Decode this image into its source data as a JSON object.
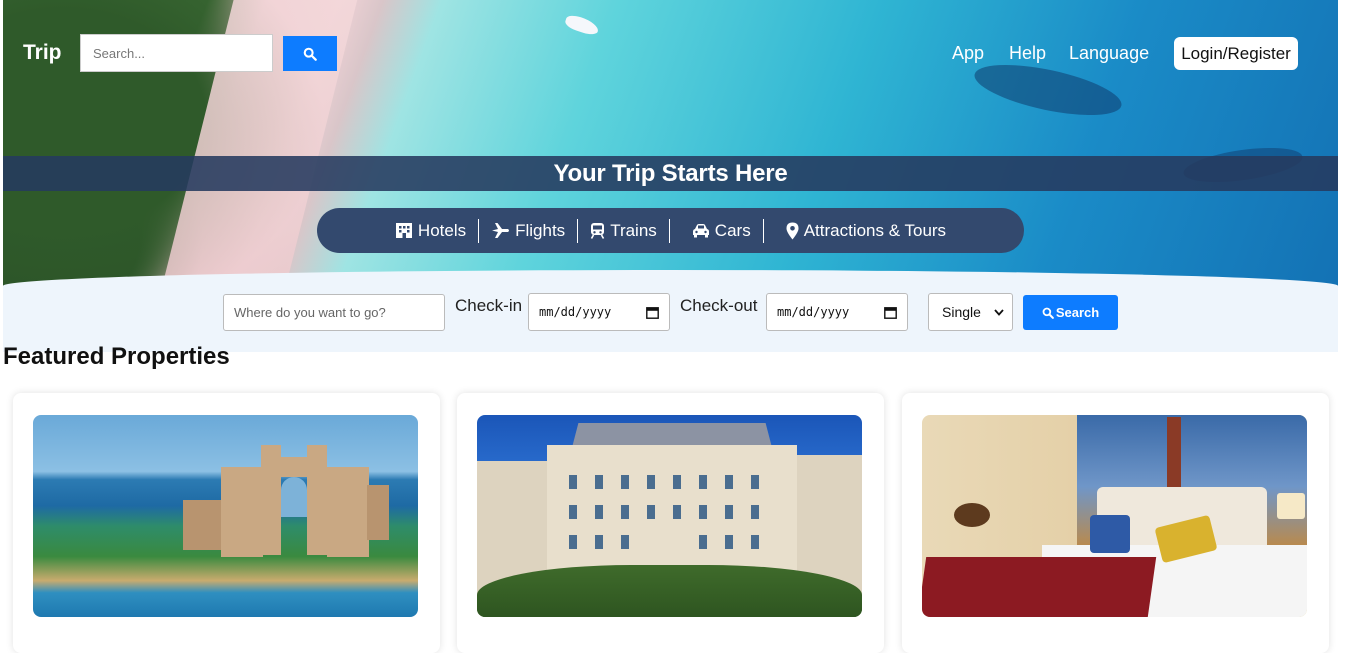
{
  "header": {
    "brand": "Trip",
    "search_placeholder": "Search...",
    "nav": [
      "App",
      "Help",
      "Language"
    ],
    "login_label": "Login/Register"
  },
  "hero": {
    "banner_title": "Your Trip Starts Here",
    "categories": [
      {
        "label": "Hotels",
        "icon": "hotel-icon"
      },
      {
        "label": "Flights",
        "icon": "plane-icon"
      },
      {
        "label": "Trains",
        "icon": "train-icon"
      },
      {
        "label": "Cars",
        "icon": "car-icon"
      },
      {
        "label": "Attractions & Tours",
        "icon": "map-marker-icon"
      }
    ]
  },
  "search_form": {
    "destination_placeholder": "Where do you want to go?",
    "checkin_label": "Check-in",
    "checkin_value": "mm/dd/yyyy",
    "checkout_label": "Check-out",
    "checkout_value": "mm/dd/yyyy",
    "room_selected": "Single",
    "search_label": "Search"
  },
  "featured": {
    "title": "Featured Properties"
  },
  "colors": {
    "accent": "#0d7cff",
    "banner": "#33496e",
    "panel": "#eef5fc"
  }
}
